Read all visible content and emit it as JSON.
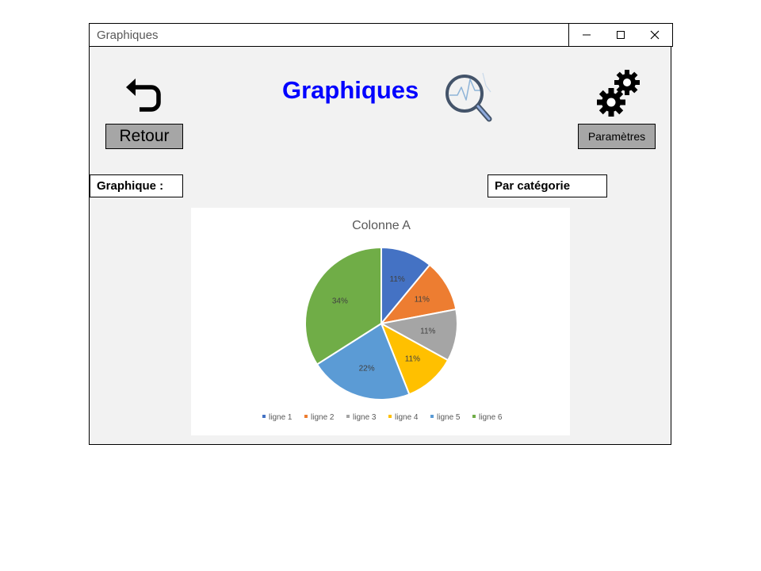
{
  "window": {
    "title": "Graphiques"
  },
  "header": {
    "title": "Graphiques",
    "back_label": "Retour",
    "settings_label": "Paramètres",
    "title_color": "#0000ff"
  },
  "icons": {
    "back": "undo-arrow-icon",
    "analytics": "search-chart-icon",
    "settings": "gears-icon",
    "minimize": "minimize-icon",
    "maximize": "maximize-icon",
    "close": "close-icon"
  },
  "fields": {
    "chart_label": "Graphique :",
    "mode_value": "Par catégorie"
  },
  "chart_data": {
    "type": "pie",
    "title": "Colonne A",
    "categories": [
      "ligne 1",
      "ligne 2",
      "ligne 3",
      "ligne 4",
      "ligne 5",
      "ligne 6"
    ],
    "values": [
      11,
      11,
      11,
      11,
      22,
      34
    ],
    "data_labels": [
      "11%",
      "11%",
      "11%",
      "11%",
      "22%",
      "34%"
    ],
    "colors": [
      "#4472c4",
      "#ed7d31",
      "#a5a5a5",
      "#ffc000",
      "#5b9bd5",
      "#70ad47"
    ],
    "legend_position": "bottom"
  }
}
